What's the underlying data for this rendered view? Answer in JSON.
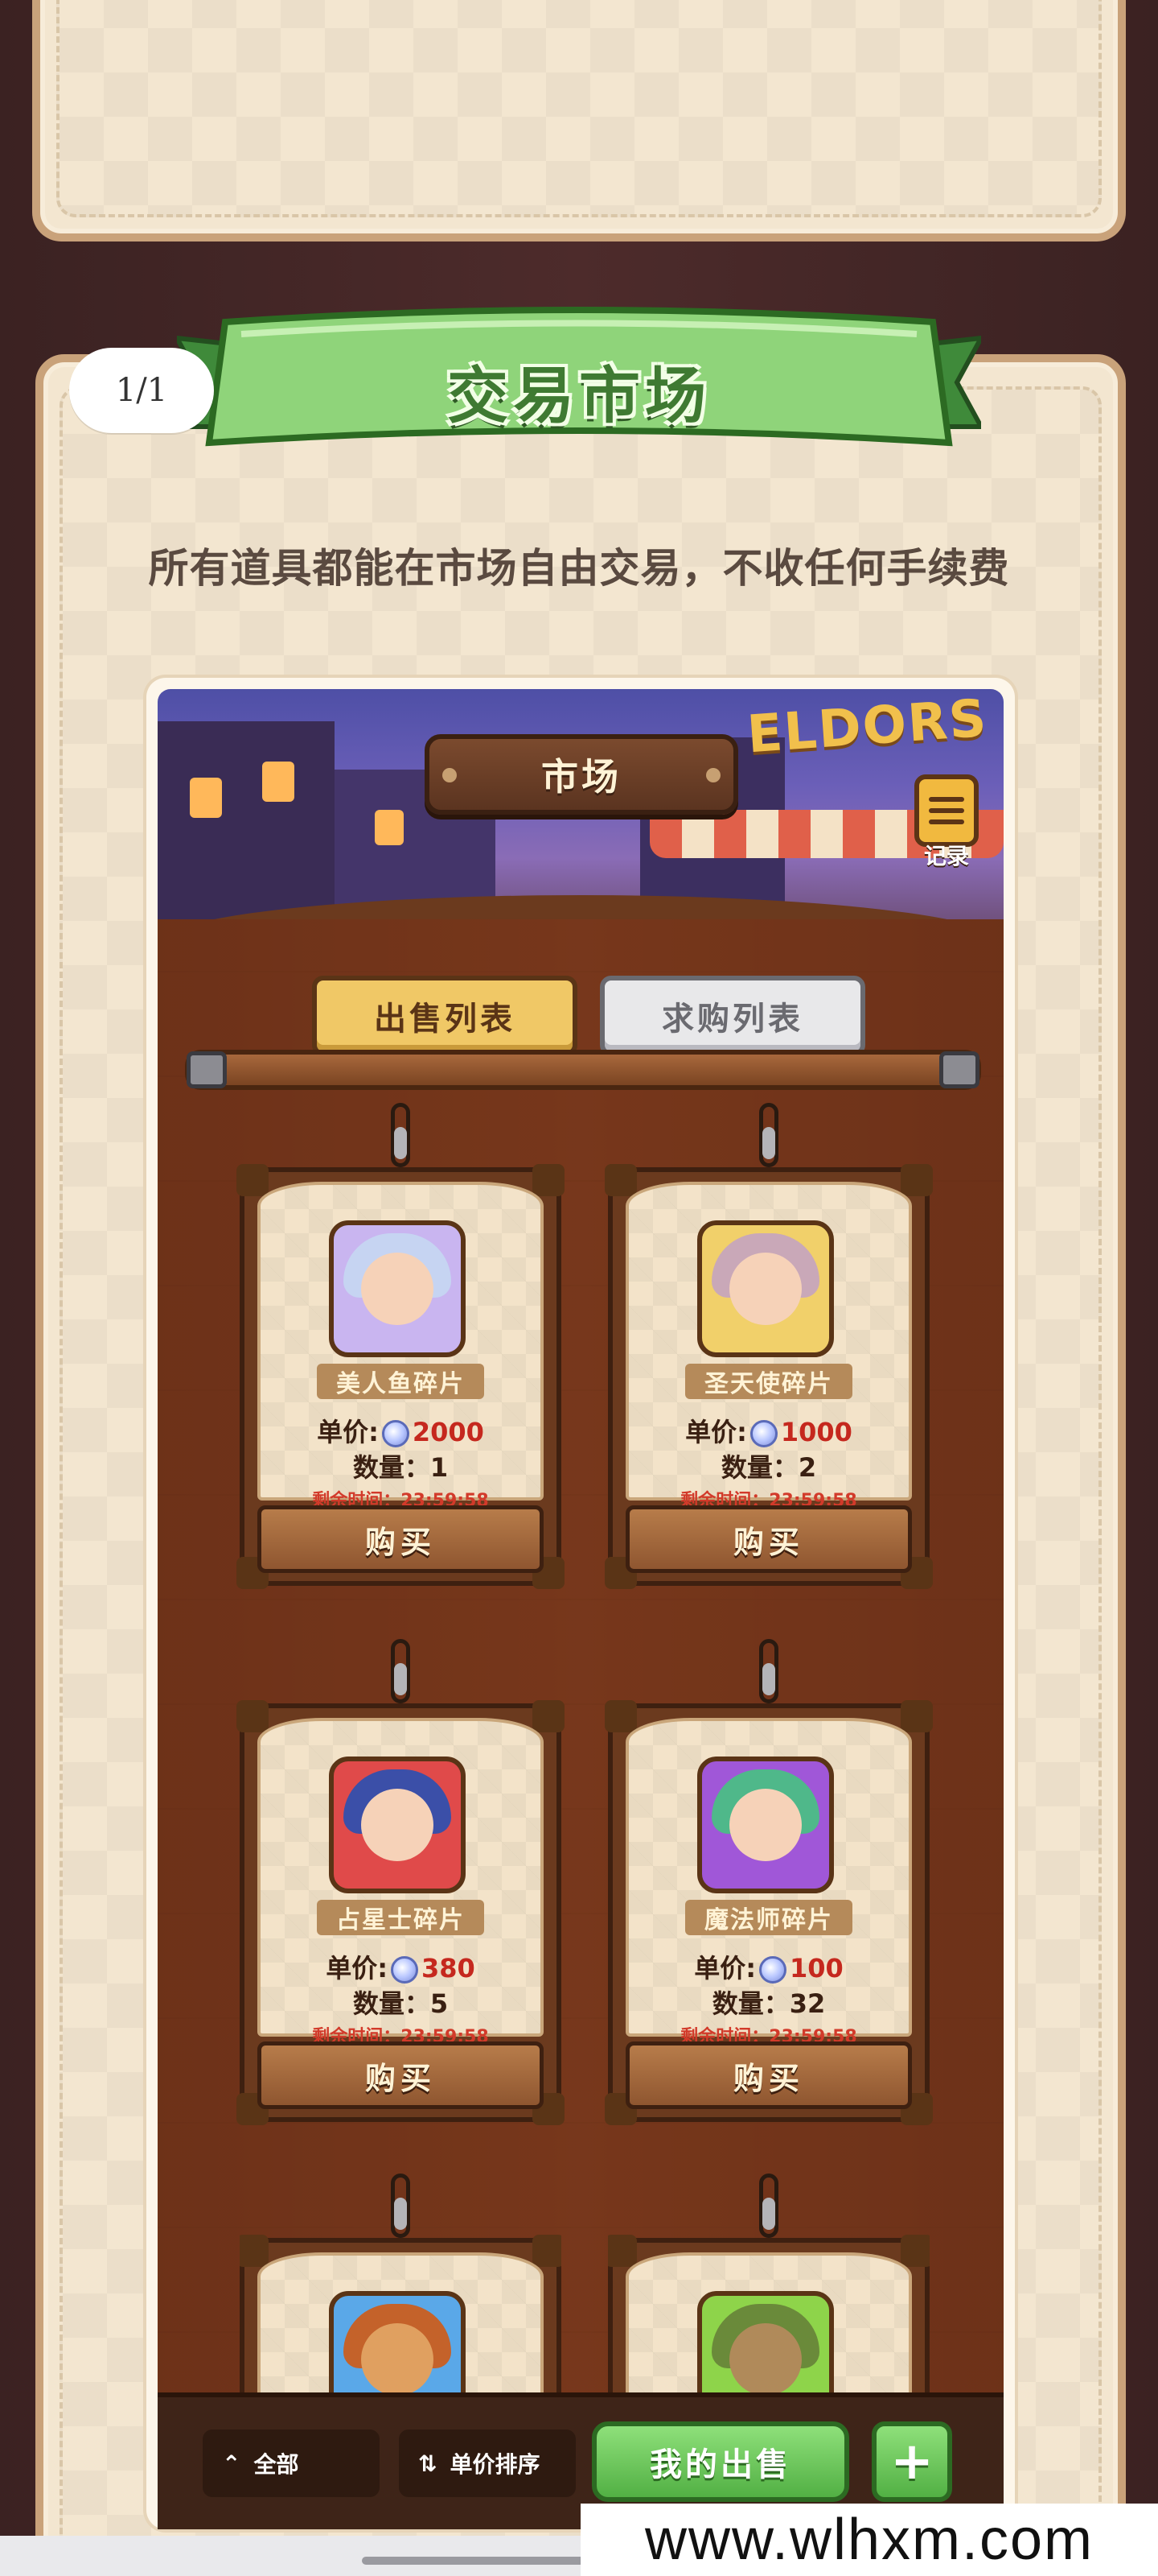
{
  "page_badge": "1/1",
  "banner_title": "交易市场",
  "subtitle": "所有道具都能在市场自由交易，不收任何手续费",
  "game": {
    "scene_logo": "ELDORS",
    "market_title": "市场",
    "record_label": "记录",
    "tabs": {
      "sell": "出售列表",
      "buy": "求购列表",
      "active": "sell"
    },
    "price_label": "单价:",
    "qty_label": "数量：",
    "buy_button": "购买",
    "items": [
      {
        "name": "美人鱼碎片",
        "price": "2000",
        "qty": "1",
        "time": "剩余时间：23:59:58",
        "portrait_color": "#c9b5f0"
      },
      {
        "name": "圣天使碎片",
        "price": "1000",
        "qty": "2",
        "time": "剩余时间：23:59:58",
        "portrait_color": "#f1d06a"
      },
      {
        "name": "占星士碎片",
        "price": "380",
        "qty": "5",
        "time": "剩余时间：23:59:58",
        "portrait_color": "#e04a4a"
      },
      {
        "name": "魔法师碎片",
        "price": "100",
        "qty": "32",
        "time": "剩余时间：23:59:58",
        "portrait_color": "#a057d8"
      },
      {
        "name": "",
        "portrait_color": "#5aa8e8"
      },
      {
        "name": "",
        "portrait_color": "#8ed44a"
      }
    ],
    "bottom": {
      "filter_all": "全部",
      "filter_sort": "单价排序",
      "my_sale": "我的出售",
      "plus": "+"
    }
  },
  "watermark": "www.wlhxm.com"
}
